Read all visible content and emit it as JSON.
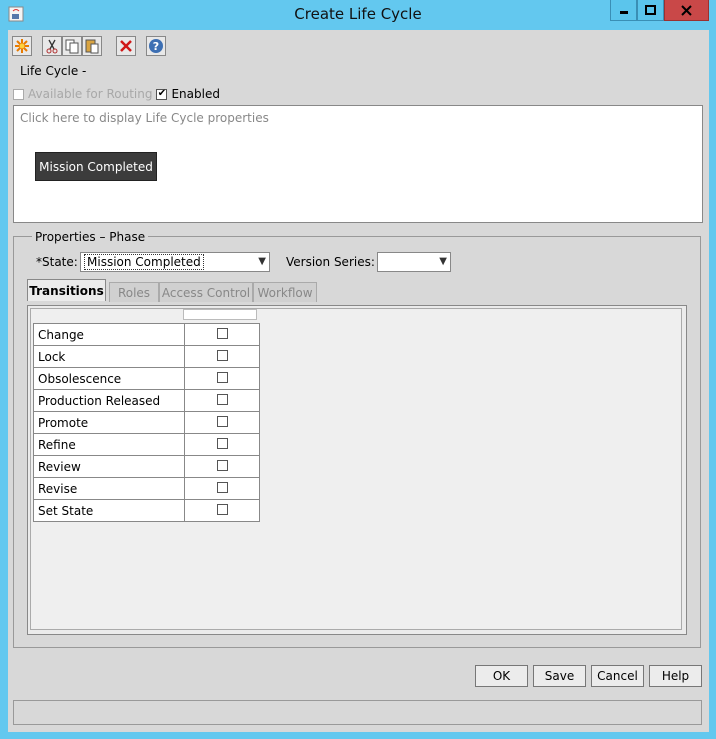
{
  "window": {
    "title": "Create Life Cycle"
  },
  "toolbar": {
    "buttons": [
      {
        "icon": "new-icon"
      },
      {
        "icon": "cut-icon"
      },
      {
        "icon": "copy-icon"
      },
      {
        "icon": "paste-icon"
      },
      {
        "icon": "delete-icon"
      },
      {
        "icon": "help-icon"
      }
    ]
  },
  "lifecycle": {
    "label": "Life Cycle -",
    "available_for_routing_label": "Available for Routing",
    "available_for_routing_checked": false,
    "enabled_label": "Enabled",
    "enabled_checked": true
  },
  "canvas": {
    "hint": "Click here to display Life Cycle properties",
    "node_label": "Mission Completed"
  },
  "properties": {
    "legend": "Properties – Phase",
    "state_label": "*State:",
    "state_value": "Mission Completed",
    "version_series_label": "Version Series:",
    "version_series_value": ""
  },
  "tabs": [
    {
      "label": "Transitions",
      "active": true
    },
    {
      "label": "Roles",
      "active": false
    },
    {
      "label": "Access Control",
      "active": false
    },
    {
      "label": "Workflow",
      "active": false
    }
  ],
  "transitions": [
    {
      "name": "Change",
      "checked": false
    },
    {
      "name": "Lock",
      "checked": false
    },
    {
      "name": "Obsolescence",
      "checked": false
    },
    {
      "name": "Production Released",
      "checked": false
    },
    {
      "name": "Promote",
      "checked": false
    },
    {
      "name": "Refine",
      "checked": false
    },
    {
      "name": "Review",
      "checked": false
    },
    {
      "name": "Revise",
      "checked": false
    },
    {
      "name": "Set State",
      "checked": false
    }
  ],
  "buttons": {
    "ok": "OK",
    "save": "Save",
    "cancel": "Cancel",
    "help": "Help"
  }
}
